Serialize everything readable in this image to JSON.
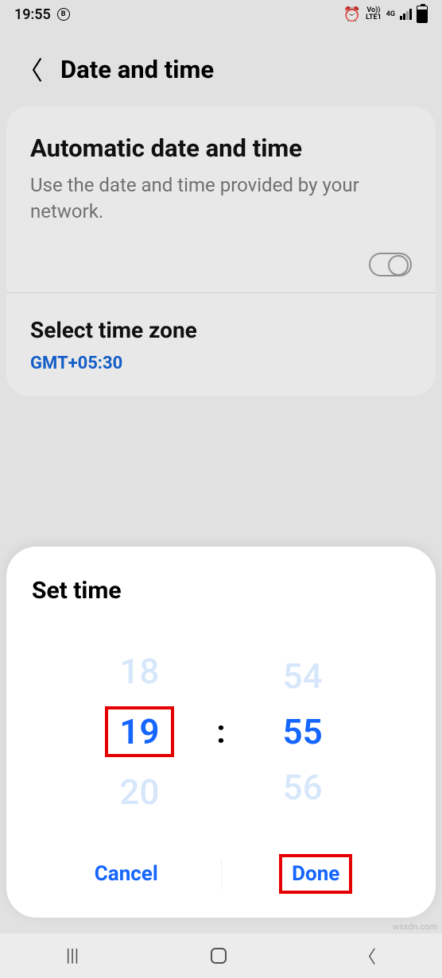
{
  "status": {
    "time": "19:55",
    "net1_top": "Vo))",
    "net1_bot": "LTE1",
    "net2": "4G"
  },
  "header": {
    "title": "Date and time"
  },
  "auto": {
    "title": "Automatic date and time",
    "desc": "Use the date and time provided by your network."
  },
  "tz": {
    "title": "Select time zone",
    "value": "GMT+05:30"
  },
  "modal": {
    "title": "Set time",
    "hour_prev": "18",
    "hour_sel": "19",
    "hour_next": "20",
    "min_prev": "54",
    "min_sel": "55",
    "min_next": "56",
    "colon": ":",
    "cancel": "Cancel",
    "done": "Done"
  },
  "watermark": "wsxdn.com"
}
